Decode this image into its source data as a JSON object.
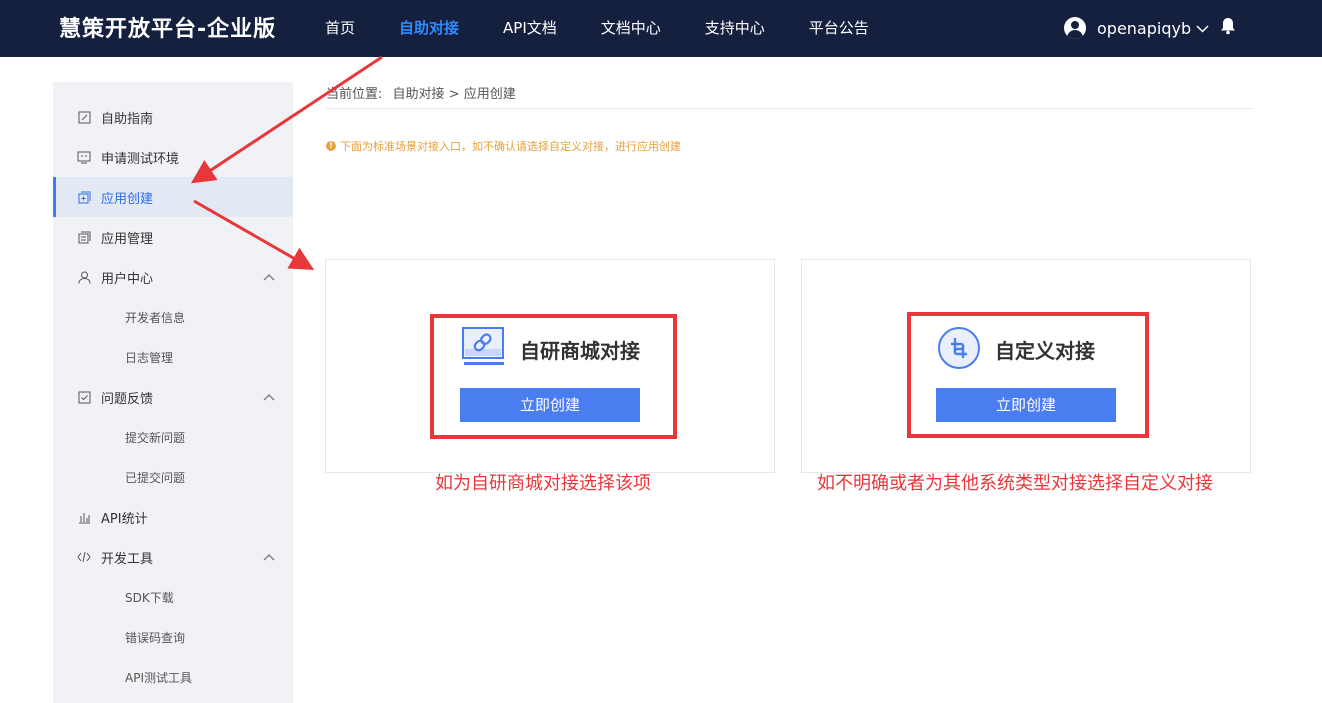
{
  "header": {
    "brand": "慧策开放平台-企业版",
    "nav": [
      "首页",
      "自助对接",
      "API文档",
      "文档中心",
      "支持中心",
      "平台公告"
    ],
    "active_nav": "自助对接",
    "username": "openapiqyb",
    "icons": [
      "user-avatar-icon",
      "chevron-down-icon",
      "bell-icon"
    ]
  },
  "sidebar": {
    "items": [
      {
        "label": "自助指南",
        "icon": "edit-doc-icon"
      },
      {
        "label": "申请测试环境",
        "icon": "monitor-icon"
      },
      {
        "label": "应用创建",
        "icon": "add-square-icon",
        "active": true
      },
      {
        "label": "应用管理",
        "icon": "list-doc-icon"
      },
      {
        "label": "用户中心",
        "icon": "user-icon",
        "expanded": true
      },
      {
        "label": "开发者信息",
        "sub": true
      },
      {
        "label": "日志管理",
        "sub": true
      },
      {
        "label": "问题反馈",
        "icon": "feedback-icon",
        "expanded": true
      },
      {
        "label": "提交新问题",
        "sub": true
      },
      {
        "label": "已提交问题",
        "sub": true
      },
      {
        "label": "API统计",
        "icon": "bar-chart-icon"
      },
      {
        "label": "开发工具",
        "icon": "code-icon",
        "expanded": true
      },
      {
        "label": "SDK下载",
        "sub": true
      },
      {
        "label": "错误码查询",
        "sub": true
      },
      {
        "label": "API测试工具",
        "sub": true
      }
    ]
  },
  "breadcrumb": {
    "prefix": "当前位置:",
    "path": "自助对接 > 应用创建"
  },
  "notice": "下面为标准场景对接入口，如不确认请选择自定义对接，进行应用创建",
  "cards": [
    {
      "title": "自研商城对接",
      "button": "立即创建",
      "icon": "link-monitor-icon"
    },
    {
      "title": "自定义对接",
      "button": "立即创建",
      "icon": "custom-link-icon"
    }
  ],
  "annotations": [
    "如为自研商城对接选择该项",
    "如不明确或者为其他系统类型对接选择自定义对接"
  ],
  "colors": {
    "header_bg": "#15203f",
    "accent": "#2f8bff",
    "button": "#4a7df0",
    "highlight_red": "#e8373b",
    "warning": "#e6a23c"
  }
}
